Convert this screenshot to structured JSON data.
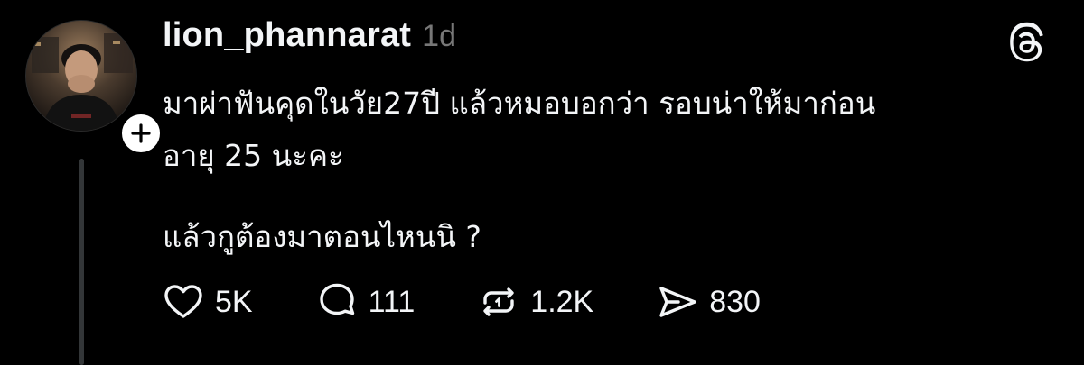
{
  "post": {
    "author": {
      "username": "lion_phannarat",
      "avatar_icon": "profile-photo",
      "follow_icon": "plus-icon"
    },
    "timestamp": "1d",
    "app_logo_icon": "threads-logo-icon",
    "content": {
      "line_1": "มาผ่าฟันคุดในวัย27ปี แล้วหมอบอกว่า รอบน่าให้มาก่อน",
      "line_2": "อายุ 25 นะคะ",
      "line_3": "แล้วกูต้องมาตอนไหนนิ ?"
    },
    "actions": {
      "like": {
        "icon": "heart-icon",
        "count": "5K"
      },
      "reply": {
        "icon": "comment-icon",
        "count": "111"
      },
      "repost": {
        "icon": "repost-icon",
        "count": "1.2K"
      },
      "share": {
        "icon": "share-icon",
        "count": "830"
      }
    }
  },
  "colors": {
    "background": "#000000",
    "text_primary": "#f3f5f7",
    "text_secondary": "#777777",
    "thread_line": "#333638",
    "badge": "#ffffff"
  }
}
